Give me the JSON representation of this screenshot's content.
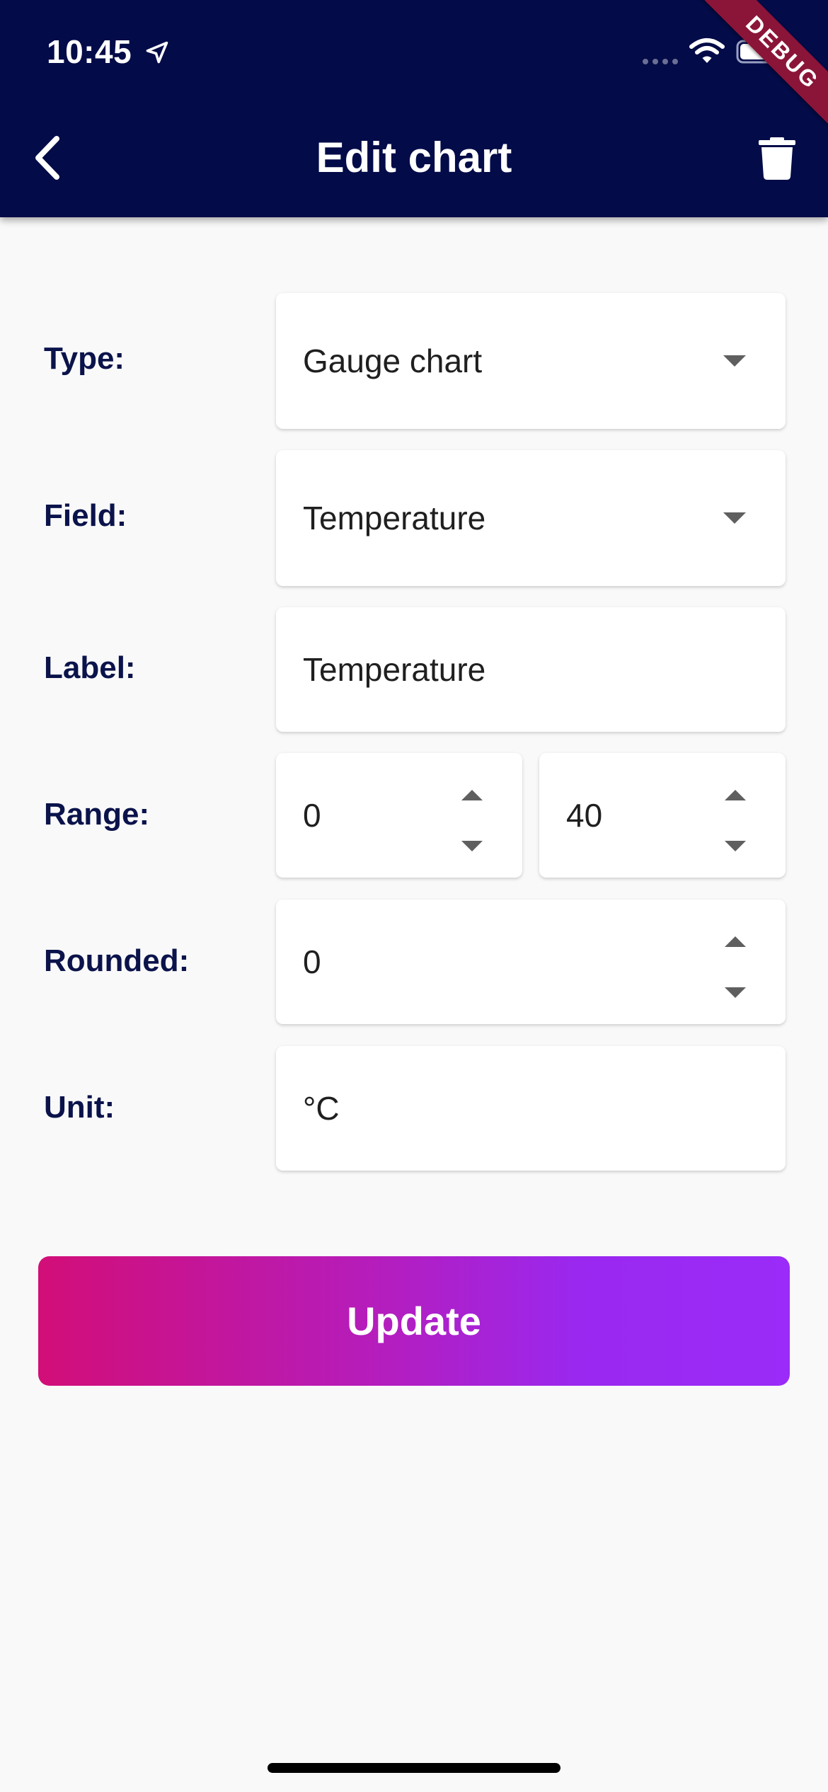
{
  "status_bar": {
    "time": "10:45"
  },
  "debug_banner": "DEBUG",
  "appbar": {
    "title": "Edit chart"
  },
  "form": {
    "type": {
      "label": "Type:",
      "value": "Gauge chart"
    },
    "field": {
      "label": "Field:",
      "value": "Temperature"
    },
    "label_field": {
      "label": "Label:",
      "value": "Temperature"
    },
    "range": {
      "label": "Range:",
      "min": "0",
      "max": "40"
    },
    "rounded": {
      "label": "Rounded:",
      "value": "0"
    },
    "unit": {
      "label": "Unit:",
      "value": "°C"
    }
  },
  "update_button": {
    "label": "Update"
  },
  "colors": {
    "appbar": "#030b48",
    "label_text": "#0b134b",
    "button_gradient_start": "#d20e78",
    "button_gradient_end": "#9a2bf8"
  },
  "icons": {
    "location": "location-arrow-icon",
    "wifi": "wifi-icon",
    "battery": "battery-icon",
    "back": "chevron-left-icon",
    "delete": "trash-icon"
  }
}
